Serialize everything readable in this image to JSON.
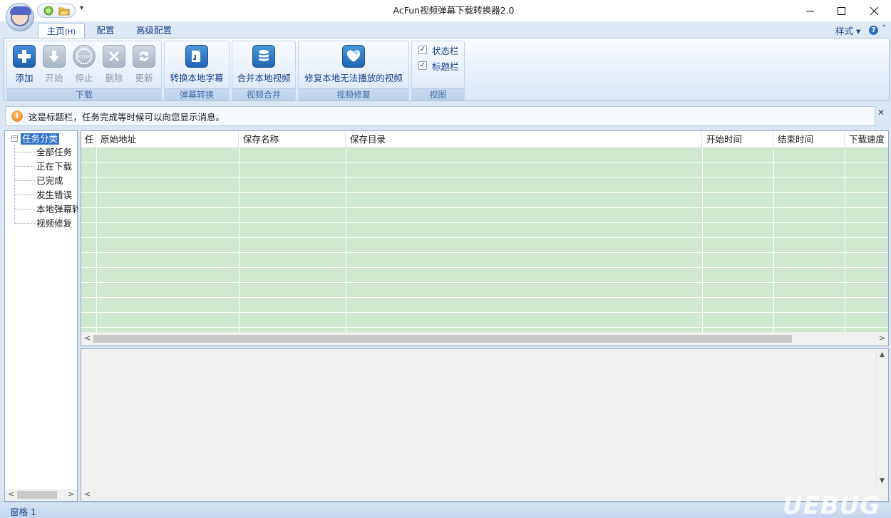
{
  "window": {
    "title": "AcFun视频弹幕下载转换器2.0",
    "min": "—",
    "max": "☐",
    "close": "✕"
  },
  "qat": {
    "more": "▾"
  },
  "tabs": [
    {
      "label": "主页",
      "hotkey": "(H)"
    },
    {
      "label": "配置"
    },
    {
      "label": "高级配置"
    }
  ],
  "style_menu": "样式 ▾",
  "help": "?",
  "ribbon_collapse": "⌃",
  "ribbon": {
    "download_group": "下载",
    "add": "添加",
    "start": "开始",
    "stop": "停止",
    "delete": "删除",
    "update": "更新",
    "danmaku_group": "弹幕转换",
    "convert_subtitle": "转换本地字幕",
    "merge_group": "视频合并",
    "merge_video": "合并本地视频",
    "repair_group": "视频修复",
    "repair_video": "修复本地无法播放的视频",
    "view_group": "视图",
    "status_bar": "状态栏",
    "title_bar": "标题栏"
  },
  "infobar": {
    "message": "这是标题栏，任务完成等时候可以向您显示消息。",
    "close": "✕"
  },
  "tree": {
    "root": "任务分类",
    "items": [
      "全部任务",
      "正在下载",
      "已完成",
      "发生错误",
      "本地弹幕转",
      "视频修复"
    ]
  },
  "grid": {
    "columns": [
      "任",
      "原始地址",
      "保存名称",
      "保存目录",
      "开始时间",
      "结束时间",
      "下载速度"
    ]
  },
  "status": {
    "text": "窗格 1"
  },
  "watermark": "UEBUG"
}
